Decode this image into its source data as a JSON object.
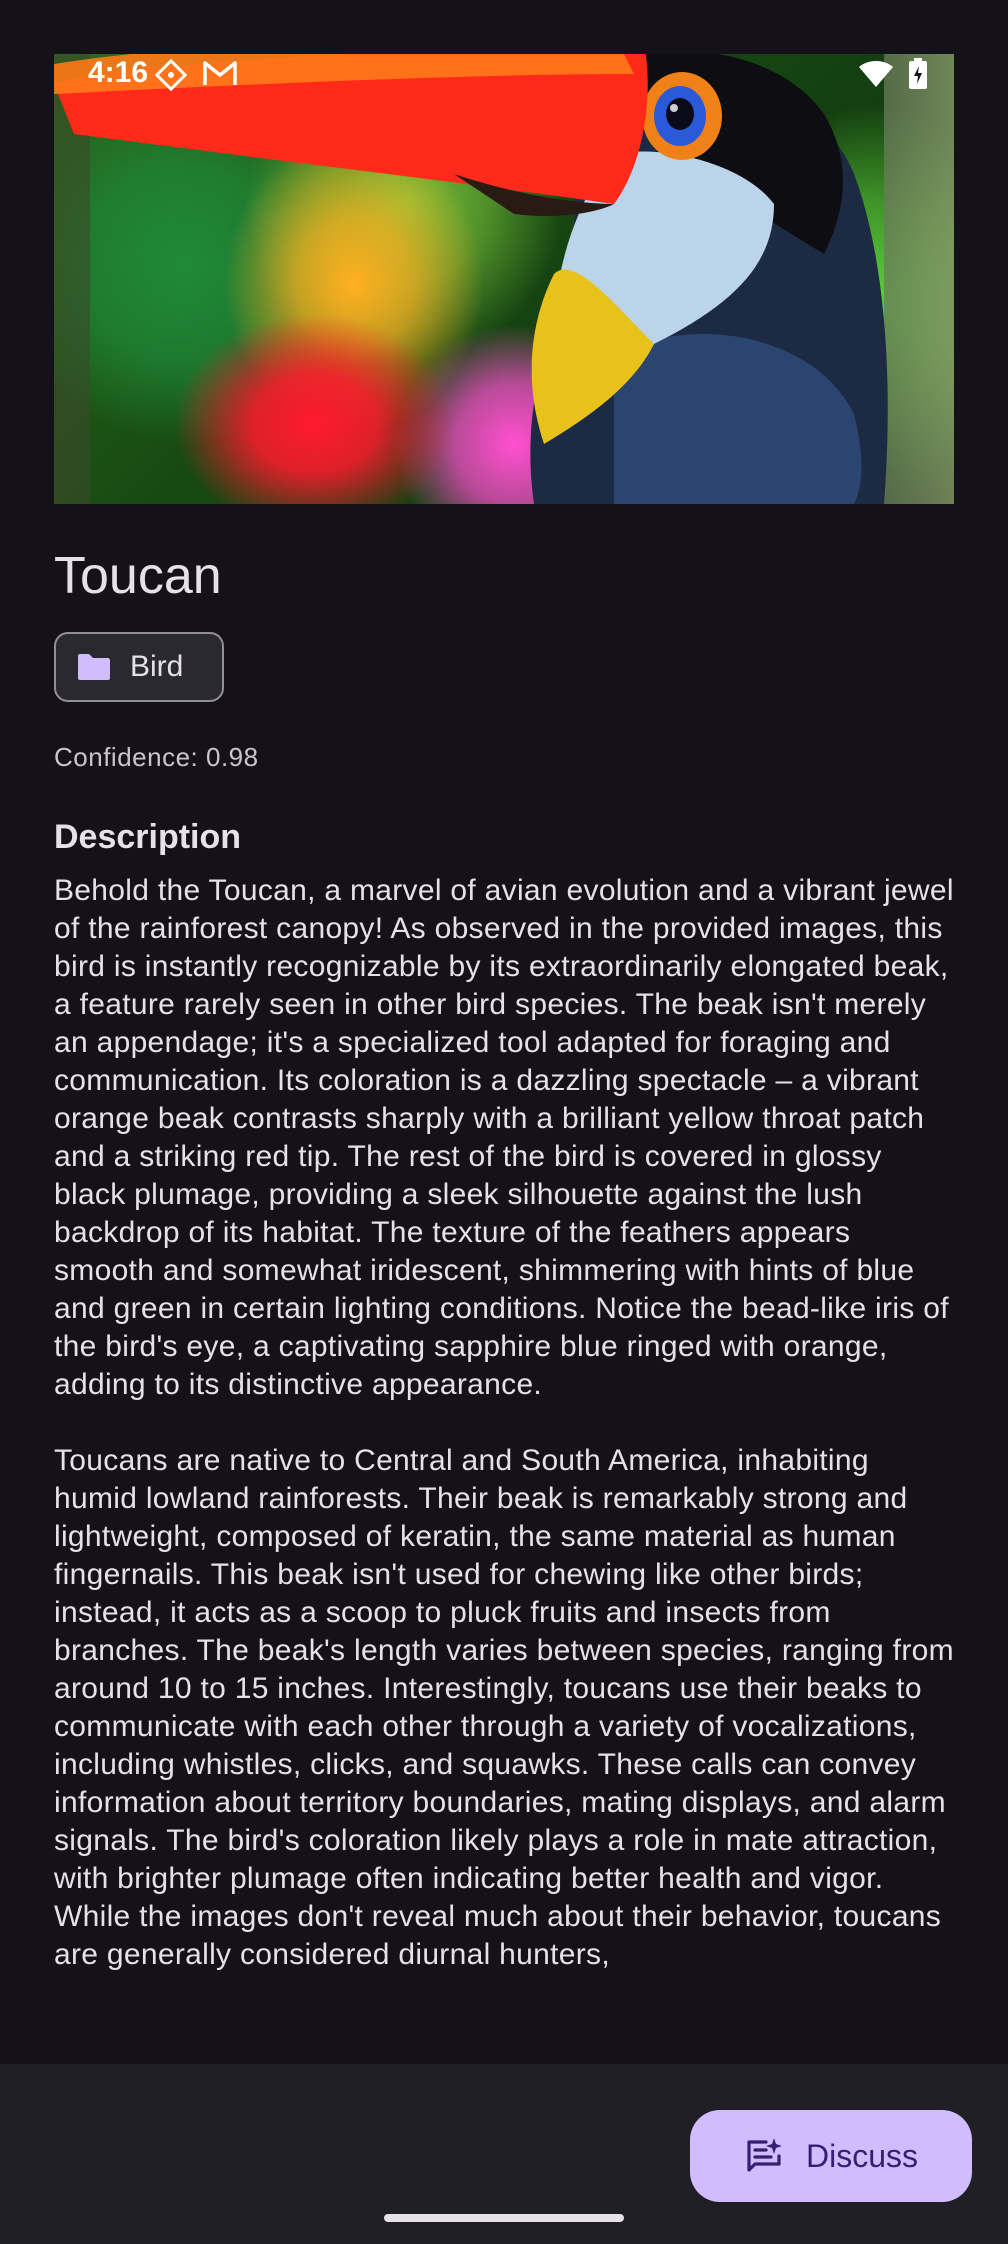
{
  "status_bar": {
    "time": "4:16",
    "left_icons": [
      "assistant-icon",
      "gmail-icon"
    ],
    "right_icons": [
      "wifi-icon",
      "battery-charging-icon"
    ]
  },
  "hero": {
    "alt_subject": "toucan-photo"
  },
  "item": {
    "title": "Toucan",
    "category_chip": {
      "icon": "folder-icon",
      "label": "Bird"
    },
    "confidence": "Confidence: 0.98"
  },
  "description": {
    "heading": "Description",
    "paragraphs": [
      "Behold the Toucan, a marvel of avian evolution and a vibrant jewel of the rainforest canopy! As observed in the provided images, this bird is instantly recognizable by its extraordinarily elongated beak, a feature rarely seen in other bird species. The beak isn't merely an appendage; it's a specialized tool adapted for foraging and communication. Its coloration is a dazzling spectacle – a vibrant orange beak contrasts sharply with a brilliant yellow throat patch and a striking red tip. The rest of the bird is covered in glossy black plumage, providing a sleek silhouette against the lush backdrop of its habitat. The texture of the feathers appears smooth and somewhat iridescent, shimmering with hints of blue and green in certain lighting conditions. Notice the bead-like iris of the bird's eye, a captivating sapphire blue ringed with orange, adding to its distinctive appearance.",
      "Toucans are native to Central and South America, inhabiting humid lowland rainforests. Their beak is remarkably strong and lightweight, composed of keratin, the same material as human fingernails. This beak isn't used for chewing like other birds; instead, it acts as a scoop to pluck fruits and insects from branches. The beak's length varies between species, ranging from around 10 to 15 inches. Interestingly, toucans use their beaks to communicate with each other through a variety of vocalizations, including whistles, clicks, and squawks. These calls can convey information about territory boundaries, mating displays, and alarm signals. The bird's coloration likely plays a role in mate attraction, with brighter plumage often indicating better health and vigor. While the images don't reveal much about their behavior, toucans are generally considered diurnal hunters,"
    ]
  },
  "fab": {
    "icon": "discuss-sparkle-icon",
    "label": "Discuss"
  },
  "colors": {
    "background": "#141218",
    "surface_bar": "#211f26",
    "fab": "#d0bcff",
    "chip_icon": "#d0bcff",
    "text_primary": "#e6e0e9",
    "text_secondary": "#cac4d0"
  }
}
